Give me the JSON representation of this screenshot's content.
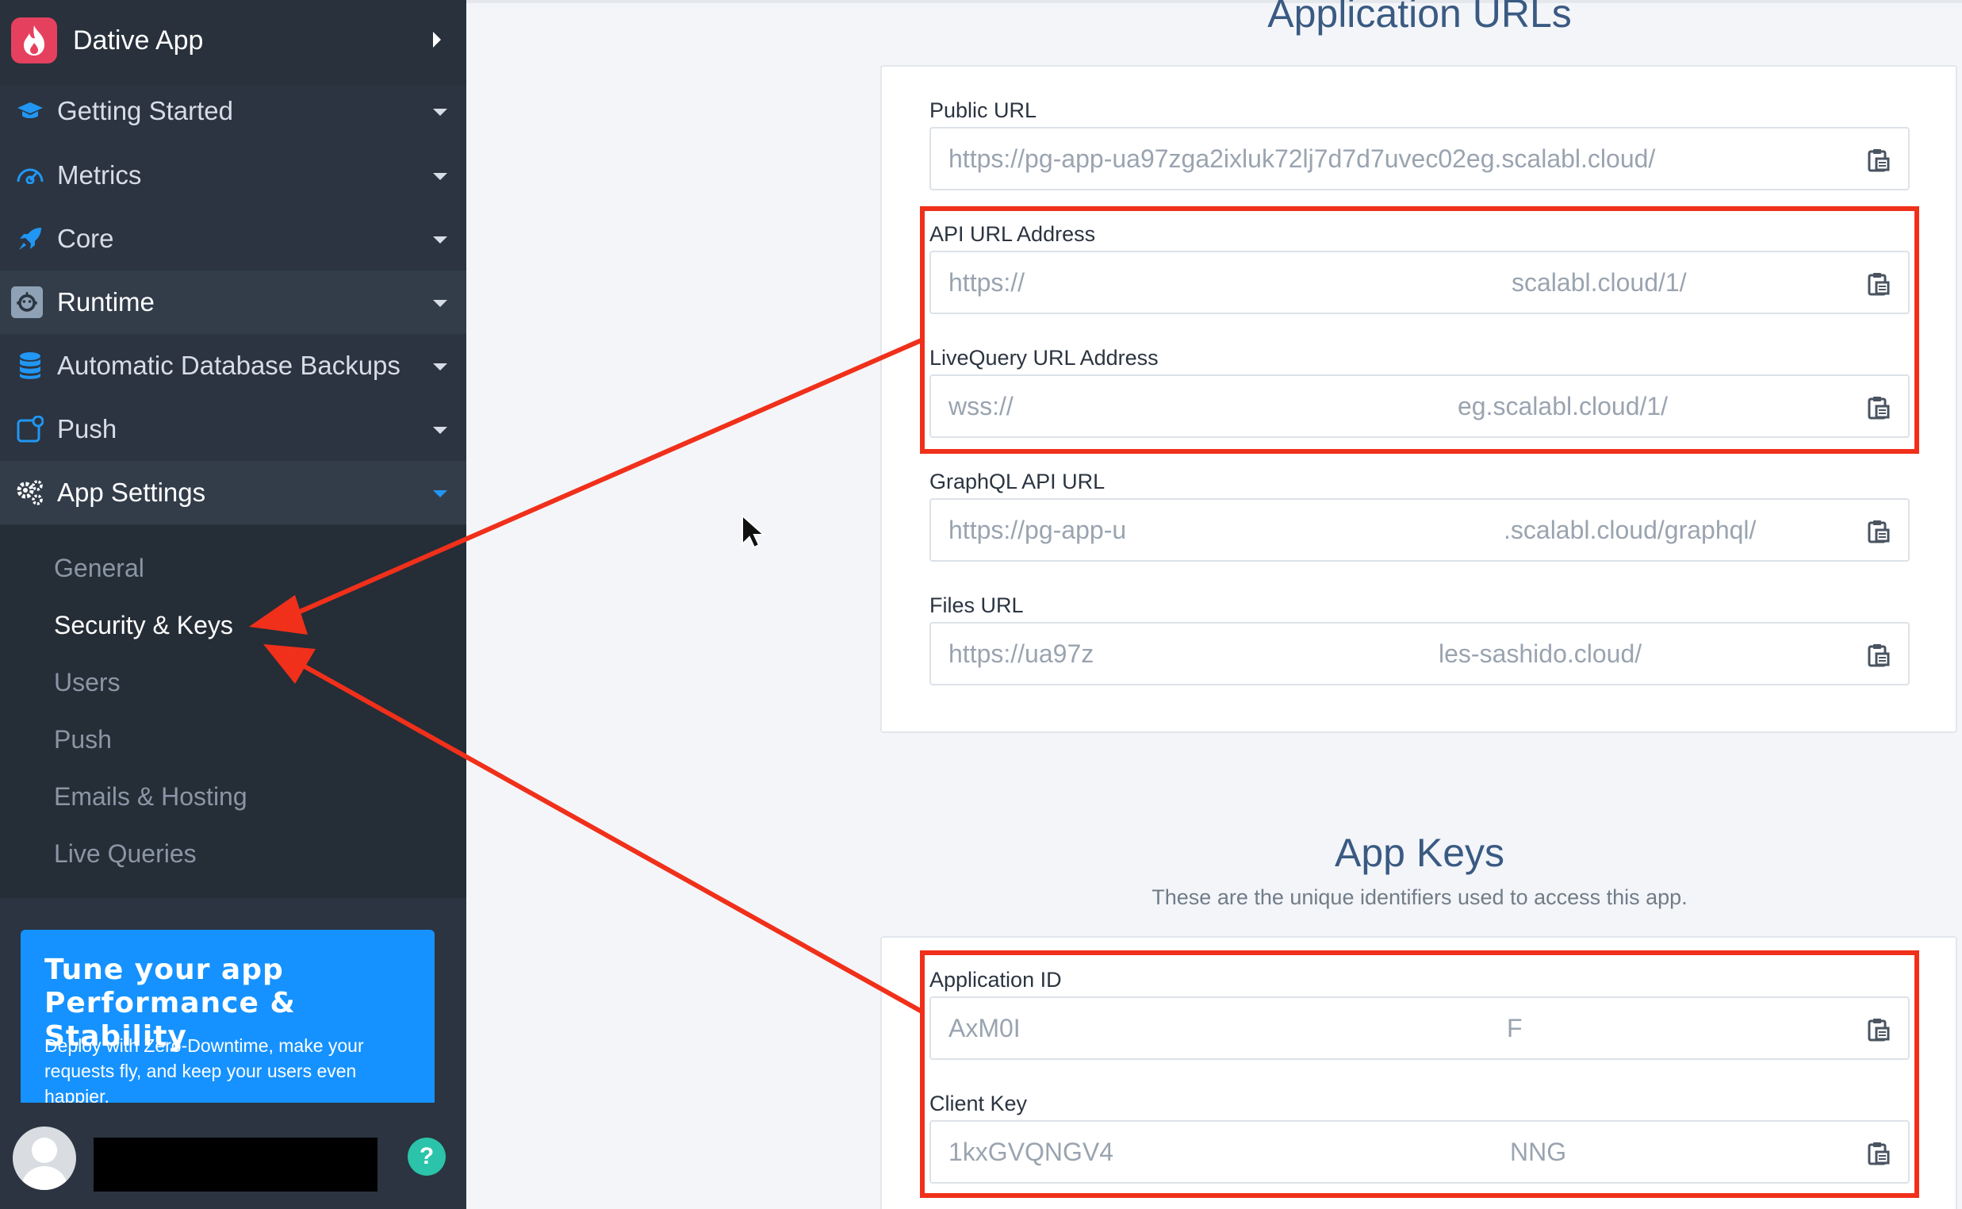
{
  "app": {
    "name": "Dative App"
  },
  "nav": {
    "items": [
      {
        "label": "Getting Started",
        "icon": "graduation-cap-icon"
      },
      {
        "label": "Metrics",
        "icon": "gauge-icon"
      },
      {
        "label": "Core",
        "icon": "rocket-icon"
      },
      {
        "label": "Runtime",
        "icon": "robot-icon"
      },
      {
        "label": "Automatic Database Backups",
        "icon": "database-icon"
      },
      {
        "label": "Push",
        "icon": "push-notification-icon"
      },
      {
        "label": "App Settings",
        "icon": "gears-icon"
      }
    ],
    "submenu": [
      "General",
      "Security & Keys",
      "Users",
      "Push",
      "Emails & Hosting",
      "Live Queries"
    ]
  },
  "promo": {
    "title": "Tune your app Performance & Stability",
    "text": "Deploy with Zero-Downtime, make your requests fly, and keep your users even happier."
  },
  "footer": {
    "help": "?"
  },
  "urls": {
    "title": "Application URLs",
    "fields": [
      {
        "label": "Public URL",
        "value": "https://pg-app-ua97zga2ixluk72lj7d7d7uvec02eg.scalabl.cloud/",
        "tail": ""
      },
      {
        "label": "API URL Address",
        "value": "https://",
        "tail": "scalabl.cloud/1/"
      },
      {
        "label": "LiveQuery URL Address",
        "value": "wss://",
        "tail": "eg.scalabl.cloud/1/"
      },
      {
        "label": "GraphQL API URL",
        "value": "https://pg-app-u",
        "tail": ".scalabl.cloud/graphql/"
      },
      {
        "label": "Files URL",
        "value": "https://ua97z",
        "tail": "les-sashido.cloud/"
      }
    ]
  },
  "keys": {
    "title": "App Keys",
    "subtitle": "These are the unique identifiers used to access this app.",
    "fields": [
      {
        "label": "Application ID",
        "value": "AxM0I",
        "tail": "F"
      },
      {
        "label": "Client Key",
        "value": "1kxGVQNGV4",
        "tail": "NNG"
      }
    ]
  },
  "colors": {
    "sidebar": "#2b3440",
    "accent": "#2196f3",
    "annotation": "#f0301a",
    "promo": "#1592ff",
    "title": "#3a5a82"
  }
}
